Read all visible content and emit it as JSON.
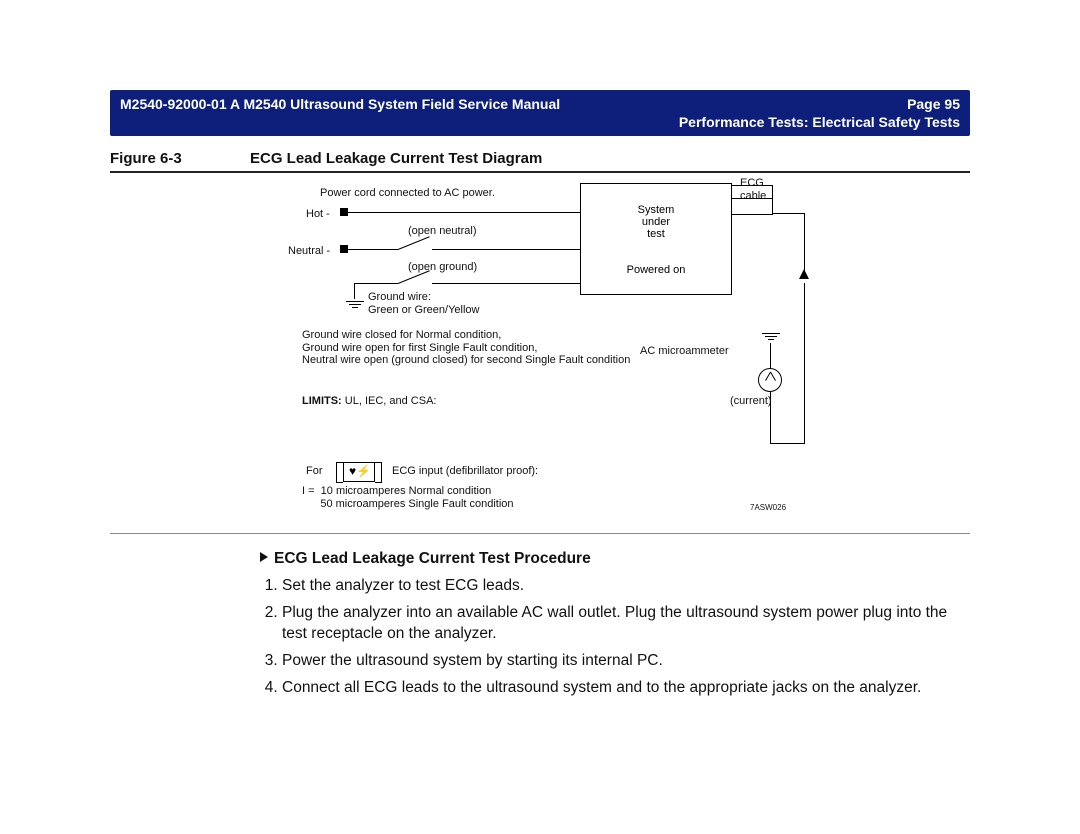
{
  "header": {
    "doc_id": "M2540-92000-01 A M2540 Ultrasound System Field Service Manual",
    "page_label": "Page 95",
    "section": "Performance Tests: Electrical Safety Tests"
  },
  "figure": {
    "label": "Figure 6-3",
    "title": "ECG Lead Leakage Current Test Diagram"
  },
  "diagram": {
    "power_cord_note": "Power cord connected to AC power.",
    "hot_label": "Hot -",
    "neutral_label": "Neutral -",
    "open_neutral": "(open neutral)",
    "open_ground": "(open ground)",
    "ground_wire_label": "Ground wire:\nGreen or Green/Yellow",
    "system_box_line1": "System",
    "system_box_line2": "under",
    "system_box_line3": "test",
    "system_box_power": "Powered on",
    "ecg_cable": "ECG\ncable",
    "ac_microammeter": "AC microammeter",
    "current_label": "(current)",
    "conditions": "Ground wire closed for Normal condition,\nGround wire open for first Single Fault condition,\nNeutral wire open (ground closed) for second Single Fault condition",
    "limits_prefix": "LIMITS:",
    "limits_body": " UL, IEC, and CSA:",
    "for_label": "For",
    "ecg_input_label": "ECG input (defibrillator proof):",
    "limits_values": "I =  10 microamperes Normal condition\n      50 microamperes Single Fault condition",
    "fig_ref": "7ASW026"
  },
  "procedure": {
    "title": "ECG Lead Leakage Current Test Procedure",
    "steps": [
      "Set the analyzer to test ECG leads.",
      "Plug the analyzer into an available AC wall outlet. Plug the ultrasound system power plug into the test receptacle on the analyzer.",
      "Power the ultrasound system by starting its internal PC.",
      "Connect all ECG leads to the ultrasound system and to the appropriate jacks on the analyzer."
    ]
  }
}
